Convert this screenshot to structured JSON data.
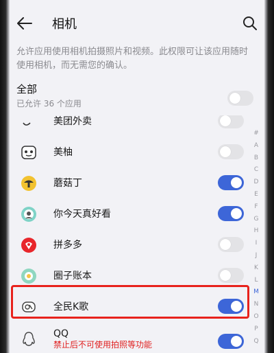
{
  "header": {
    "title": "相机",
    "back_icon": "back-arrow-icon",
    "search_icon": "search-icon"
  },
  "description": "允许应用使用相机拍摄照片和视频。此权限可让该应用随时使用相机，而无需您的确认。",
  "all_row": {
    "title": "全部",
    "subtitle": "已允许 36 个应用",
    "enabled": false
  },
  "apps": [
    {
      "name": "美团外卖",
      "icon": "meituan-waimai-icon",
      "enabled": false
    },
    {
      "name": "美柚",
      "icon": "meiyou-icon",
      "enabled": false
    },
    {
      "name": "蘑菇丁",
      "icon": "moguding-icon",
      "enabled": true
    },
    {
      "name": "你今天真好看",
      "icon": "nijintian-icon",
      "enabled": true
    },
    {
      "name": "拼多多",
      "icon": "pinduoduo-icon",
      "enabled": false
    },
    {
      "name": "圈子账本",
      "icon": "quanzi-icon",
      "enabled": false
    },
    {
      "name": "全民K歌",
      "icon": "quanmin-kge-icon",
      "enabled": true,
      "highlighted": true
    },
    {
      "name": "QQ",
      "icon": "qq-icon",
      "enabled": true,
      "subtitle": "禁止后不可使用拍照等功能"
    }
  ],
  "index_letters": [
    "#",
    "A",
    "B",
    "C",
    "D",
    "E",
    "F",
    "G",
    "H",
    "I",
    "J",
    "K",
    "L",
    "M",
    "N",
    "O",
    "P",
    "Q"
  ],
  "index_active": "M",
  "colors": {
    "accent": "#3d66d8",
    "highlight": "#e8221c",
    "warning_text": "#e02020"
  }
}
